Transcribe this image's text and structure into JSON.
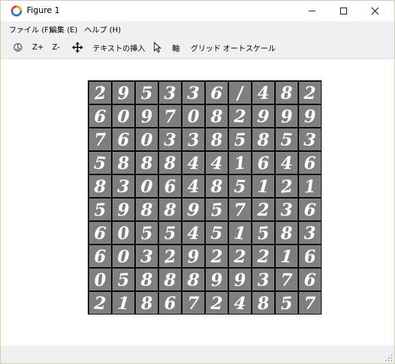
{
  "window": {
    "title": "Figure 1"
  },
  "menubar": [
    {
      "label": "ファイル (F)"
    },
    {
      "label": "編集 (E)"
    },
    {
      "label": "ヘルプ (H)"
    }
  ],
  "toolbar": {
    "home_icon": "home-icon",
    "zoom_in_label": "Z+",
    "zoom_out_label": "Z-",
    "pan_icon": "pan-icon",
    "insert_text_label": "テキストの挿入",
    "pointer_icon": "pointer-icon",
    "axes_label": "軸",
    "grid_label": "グリッド",
    "autoscale_label": "オートスケール"
  },
  "figure": {
    "rows": 10,
    "cols": 10,
    "cell_background": "#7f7f7f",
    "border_color": "#000000",
    "digit_color": "#ffffff",
    "digits": [
      [
        "2",
        "9",
        "5",
        "3",
        "3",
        "6",
        "/",
        "4",
        "8",
        "2"
      ],
      [
        "6",
        "0",
        "9",
        "7",
        "0",
        "8",
        "2",
        "9",
        "9",
        "9"
      ],
      [
        "7",
        "6",
        "0",
        "3",
        "3",
        "8",
        "5",
        "8",
        "5",
        "3"
      ],
      [
        "5",
        "8",
        "8",
        "8",
        "4",
        "4",
        "1",
        "6",
        "4",
        "6"
      ],
      [
        "8",
        "3",
        "0",
        "6",
        "4",
        "8",
        "5",
        "1",
        "2",
        "1"
      ],
      [
        "5",
        "9",
        "8",
        "8",
        "9",
        "5",
        "7",
        "2",
        "3",
        "6"
      ],
      [
        "6",
        "0",
        "5",
        "5",
        "4",
        "5",
        "1",
        "5",
        "8",
        "3"
      ],
      [
        "6",
        "0",
        "3",
        "2",
        "9",
        "2",
        "2",
        "2",
        "1",
        "6"
      ],
      [
        "0",
        "5",
        "8",
        "8",
        "8",
        "9",
        "9",
        "3",
        "7",
        "6"
      ],
      [
        "2",
        "1",
        "8",
        "6",
        "7",
        "2",
        "4",
        "8",
        "5",
        "7"
      ]
    ]
  },
  "colors": {
    "chrome": "#f0f0f0",
    "window_border": "#d4c4a8"
  }
}
